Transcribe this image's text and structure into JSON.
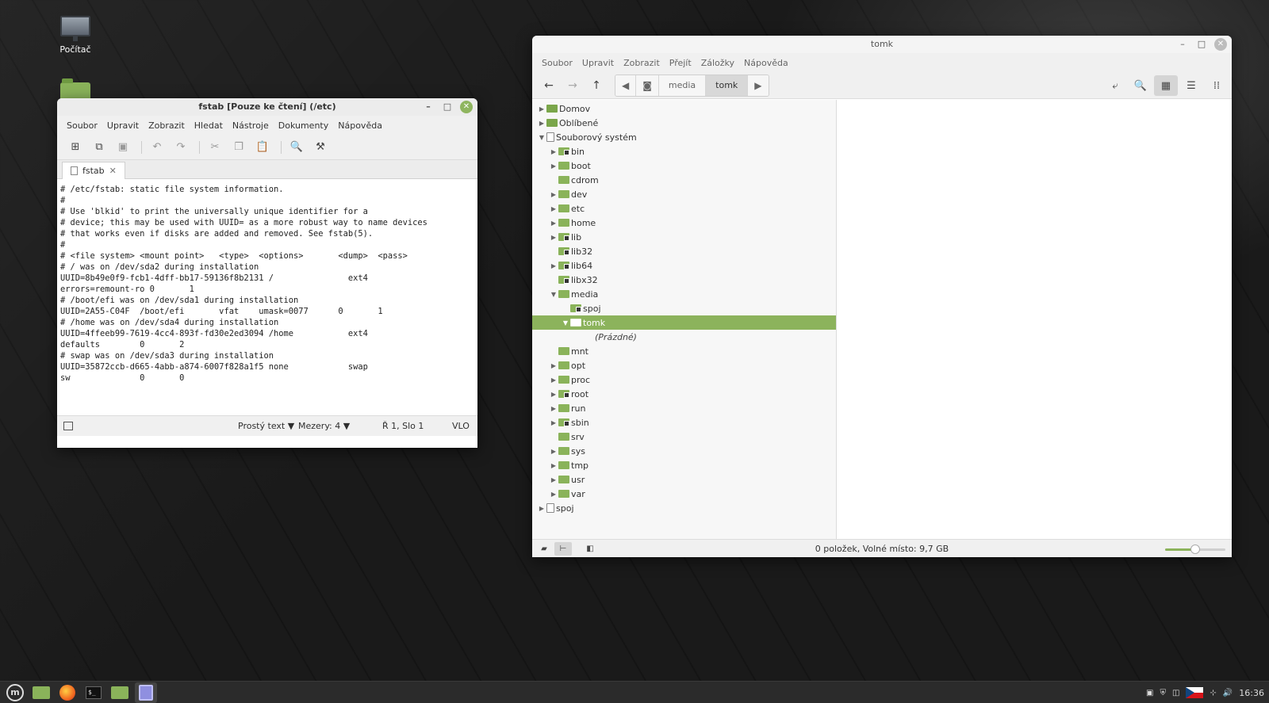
{
  "desktop": {
    "icons": [
      {
        "label": "Počítač",
        "icon": "computer-icon"
      },
      {
        "label": "",
        "icon": "home-folder-icon"
      }
    ]
  },
  "editor": {
    "title": "fstab [Pouze ke čtení] (/etc)",
    "menu": [
      "Soubor",
      "Upravit",
      "Zobrazit",
      "Hledat",
      "Nástroje",
      "Dokumenty",
      "Nápověda"
    ],
    "toolbar": [
      "new-document-icon",
      "open-icon",
      "save-icon",
      "undo-icon",
      "redo-icon",
      "cut-icon",
      "copy-icon",
      "paste-icon",
      "search-icon",
      "replace-icon"
    ],
    "tab_label": "fstab",
    "content": "# /etc/fstab: static file system information.\n#\n# Use 'blkid' to print the universally unique identifier for a\n# device; this may be used with UUID= as a more robust way to name devices\n# that works even if disks are added and removed. See fstab(5).\n#\n# <file system> <mount point>   <type>  <options>       <dump>  <pass>\n# / was on /dev/sda2 during installation\nUUID=8b49e0f9-fcb1-4dff-bb17-59136f8b2131 /               ext4\nerrors=remount-ro 0       1\n# /boot/efi was on /dev/sda1 during installation\nUUID=2A55-C04F  /boot/efi       vfat    umask=0077      0       1\n# /home was on /dev/sda4 during installation\nUUID=4ffeeb99-7619-4cc4-893f-fd30e2ed3094 /home           ext4\ndefaults        0       2\n# swap was on /dev/sda3 during installation\nUUID=35872ccb-d665-4abb-a874-6007f828a1f5 none            swap\nsw              0       0",
    "status": {
      "syntax": "Prostý text",
      "spaces": "Mezery: 4",
      "position": "Ř 1, Slo 1",
      "mode": "VLO"
    }
  },
  "filemanager": {
    "title": "tomk",
    "menu": [
      "Soubor",
      "Upravit",
      "Zobrazit",
      "Přejít",
      "Záložky",
      "Nápověda"
    ],
    "breadcrumbs": [
      "media",
      "tomk"
    ],
    "tree": [
      {
        "label": "Domov",
        "level": 0,
        "arrow": "▶",
        "icon": "home"
      },
      {
        "label": "Oblíbené",
        "level": 0,
        "arrow": "▶",
        "icon": "home"
      },
      {
        "label": "Souborový systém",
        "level": 0,
        "arrow": "▼",
        "icon": "fs"
      },
      {
        "label": "bin",
        "level": 1,
        "arrow": "▶",
        "icon": "lock"
      },
      {
        "label": "boot",
        "level": 1,
        "arrow": "▶",
        "icon": "folder"
      },
      {
        "label": "cdrom",
        "level": 1,
        "arrow": "",
        "icon": "folder"
      },
      {
        "label": "dev",
        "level": 1,
        "arrow": "▶",
        "icon": "folder"
      },
      {
        "label": "etc",
        "level": 1,
        "arrow": "▶",
        "icon": "folder"
      },
      {
        "label": "home",
        "level": 1,
        "arrow": "▶",
        "icon": "folder"
      },
      {
        "label": "lib",
        "level": 1,
        "arrow": "▶",
        "icon": "lock"
      },
      {
        "label": "lib32",
        "level": 1,
        "arrow": "",
        "icon": "lock"
      },
      {
        "label": "lib64",
        "level": 1,
        "arrow": "▶",
        "icon": "lock"
      },
      {
        "label": "libx32",
        "level": 1,
        "arrow": "",
        "icon": "lock"
      },
      {
        "label": "media",
        "level": 1,
        "arrow": "▼",
        "icon": "folder"
      },
      {
        "label": "spoj",
        "level": 2,
        "arrow": "",
        "icon": "lock"
      },
      {
        "label": "tomk",
        "level": 2,
        "arrow": "▼",
        "icon": "open",
        "selected": true
      },
      {
        "label": "(Prázdné)",
        "level": 3,
        "arrow": "",
        "icon": "none",
        "empty": true
      },
      {
        "label": "mnt",
        "level": 1,
        "arrow": "",
        "icon": "folder"
      },
      {
        "label": "opt",
        "level": 1,
        "arrow": "▶",
        "icon": "folder"
      },
      {
        "label": "proc",
        "level": 1,
        "arrow": "▶",
        "icon": "folder"
      },
      {
        "label": "root",
        "level": 1,
        "arrow": "▶",
        "icon": "lock"
      },
      {
        "label": "run",
        "level": 1,
        "arrow": "▶",
        "icon": "folder"
      },
      {
        "label": "sbin",
        "level": 1,
        "arrow": "▶",
        "icon": "lock"
      },
      {
        "label": "srv",
        "level": 1,
        "arrow": "",
        "icon": "folder"
      },
      {
        "label": "sys",
        "level": 1,
        "arrow": "▶",
        "icon": "folder"
      },
      {
        "label": "tmp",
        "level": 1,
        "arrow": "▶",
        "icon": "folder"
      },
      {
        "label": "usr",
        "level": 1,
        "arrow": "▶",
        "icon": "folder"
      },
      {
        "label": "var",
        "level": 1,
        "arrow": "▶",
        "icon": "folder"
      },
      {
        "label": "spoj",
        "level": 0,
        "arrow": "▶",
        "icon": "fs"
      }
    ],
    "status_text": "0 položek, Volné místo: 9,7 GB",
    "zoom_level": 0.5
  },
  "taskbar": {
    "apps": [
      "mint-menu-icon",
      "files-icon",
      "firefox-icon",
      "terminal-icon",
      "folder-icon",
      "text-editor-icon"
    ],
    "clock": "16:36"
  },
  "colors": {
    "accent": "#8cb35c"
  }
}
